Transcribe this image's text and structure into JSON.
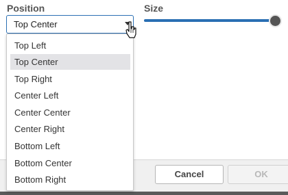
{
  "position": {
    "label": "Position",
    "selected": "Top Center",
    "options": [
      "Top Left",
      "Top Center",
      "Top Right",
      "Center Left",
      "Center Center",
      "Center Right",
      "Bottom Left",
      "Bottom Center",
      "Bottom Right"
    ],
    "selected_index": 1
  },
  "size": {
    "label": "Size",
    "value_fraction": 1.0
  },
  "footer": {
    "cancel_label": "Cancel",
    "ok_label": "OK"
  },
  "colors": {
    "accent": "#2a6fb3",
    "thumb": "#555555",
    "selected_option_bg": "#e3e3e6"
  }
}
